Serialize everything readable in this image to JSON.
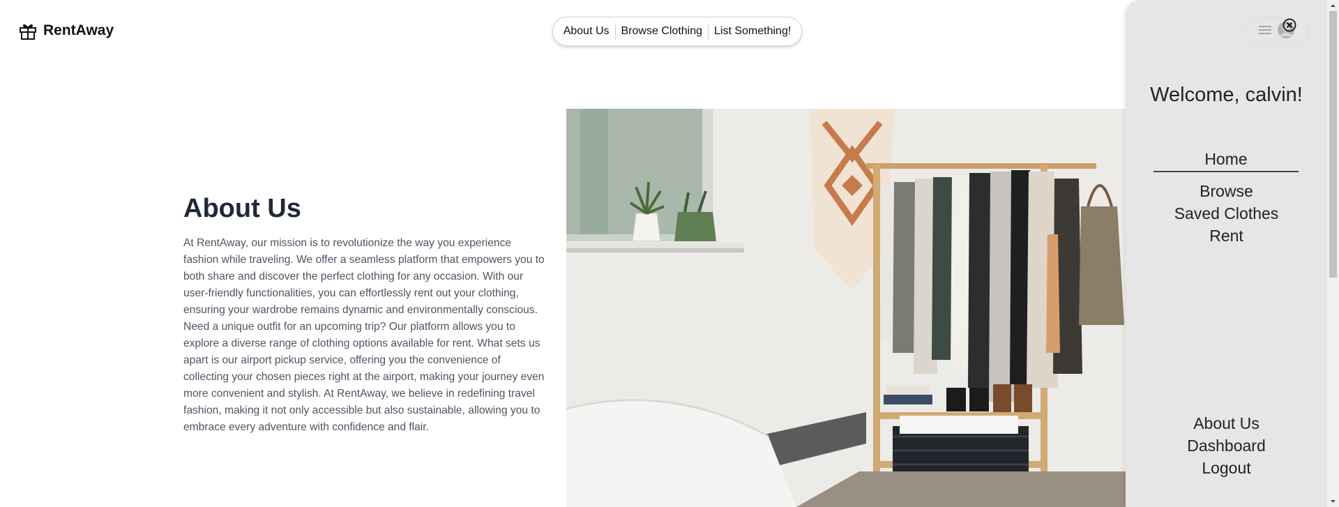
{
  "brand": {
    "name": "RentAway",
    "logo_icon": "gift-icon"
  },
  "top_nav": {
    "items": [
      "About Us",
      "Browse Clothing",
      "List Something!"
    ]
  },
  "about": {
    "title": "About Us",
    "body": "At RentAway, our mission is to revolutionize the way you experience fashion while traveling. We offer a seamless platform that empowers you to both share and discover the perfect clothing for any occasion. With our user-friendly functionalities, you can effortlessly rent out your clothing, ensuring your wardrobe remains dynamic and environmentally conscious. Need a unique outfit for an upcoming trip? Our platform allows you to explore a diverse range of clothing options available for rent. What sets us apart is our airport pickup service, offering you the convenience of collecting your chosen pieces right at the airport, making your journey even more convenient and stylish. At RentAway, we believe in redefining travel fashion, making it not only accessible but also sustainable, allowing you to embrace every adventure with confidence and flair."
  },
  "hero_image": {
    "subject": "clothing-rack-photo"
  },
  "drawer": {
    "welcome": "Welcome, calvin!",
    "home": "Home",
    "items": [
      "Browse",
      "Saved Clothes",
      "Rent"
    ],
    "bottom_items": [
      "About Us",
      "Dashboard",
      "Logout"
    ],
    "close_icon": "close-circle-icon",
    "menu_icon": "hamburger-icon",
    "avatar_icon": "user-avatar-icon"
  },
  "colors": {
    "drawer_bg": "#e6e6e6",
    "title": "#1f2937",
    "body_text": "#4b5563"
  }
}
